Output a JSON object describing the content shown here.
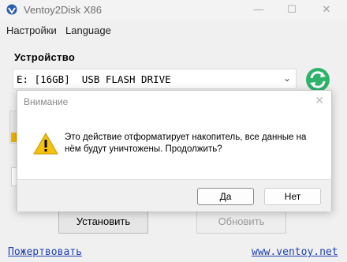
{
  "window": {
    "title": "Ventoy2Disk  X86",
    "controls": {
      "minimize": "—",
      "maximize": "☐",
      "close": "✕"
    }
  },
  "menu": [
    "Настройки",
    "Language"
  ],
  "device": {
    "group_label": "Устройство",
    "selected": "E: [16GB]  USB FLASH DRIVE"
  },
  "actions": {
    "install": "Установить",
    "update": "Обновить"
  },
  "footer": {
    "donate": "Пожертвовать",
    "website": "www.ventoy.net"
  },
  "dialog": {
    "title": "Внимание",
    "close": "✕",
    "message": "Это действие отформатирует накопитель, все данные на нём будут уничтожены. Продолжить?",
    "yes": "Да",
    "no": "Нет"
  },
  "colors": {
    "link": "#1f3fb0",
    "refresh": "#2eb36a",
    "warning": "#f4c20d"
  },
  "icons": {
    "app": "ventoy-logo-icon",
    "refresh": "refresh-icon",
    "warning": "warning-icon"
  }
}
